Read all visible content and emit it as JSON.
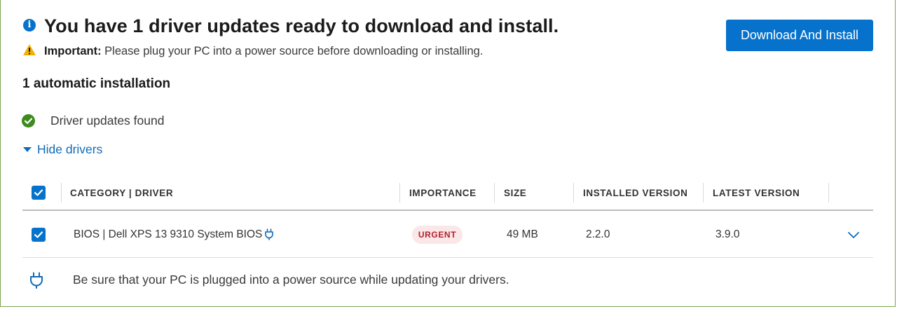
{
  "header": {
    "headline": "You have 1 driver updates ready to download and install.",
    "important_label": "Important:",
    "important_text": " Please plug your PC into a power source before downloading or installing.",
    "download_button": "Download And Install"
  },
  "section": {
    "title": "1 automatic installation",
    "status": "Driver updates found",
    "toggle_link": "Hide drivers"
  },
  "table": {
    "headers": [
      "CATEGORY | DRIVER",
      "IMPORTANCE",
      "SIZE",
      "INSTALLED VERSION",
      "LATEST VERSION"
    ],
    "select_all_checked": true,
    "rows": [
      {
        "checked": true,
        "driver": "BIOS | Dell XPS 13 9310 System BIOS",
        "importance": "URGENT",
        "size": "49 MB",
        "installed_version": "2.2.0",
        "latest_version": "3.9.0"
      }
    ]
  },
  "footer_note": "Be sure that your PC is plugged into a power source while updating your drivers.",
  "icons": {
    "info": "info-icon",
    "warning": "warning-icon",
    "status": "check-circle-icon",
    "toggle": "caret-down-icon",
    "row_power": "plug-icon",
    "expand": "chevron-down-icon",
    "note": "plug-icon"
  },
  "colors": {
    "accent": "#0672cb",
    "success": "#3d8a1d",
    "warning": "#f2b100",
    "urgent_text": "#b1212f",
    "urgent_bg": "#fbe6e8",
    "frame": "#7aa34f"
  }
}
